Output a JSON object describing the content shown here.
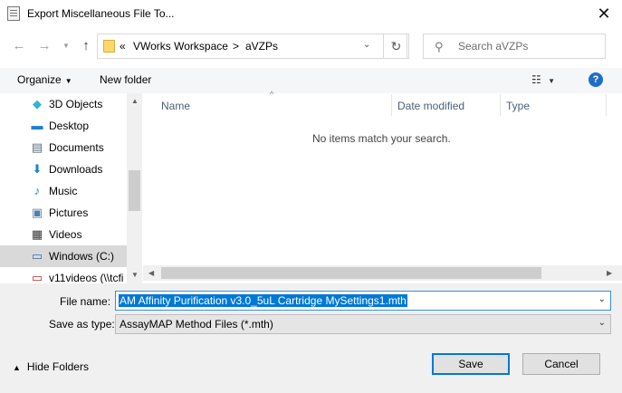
{
  "window": {
    "title": "Export Miscellaneous File To..."
  },
  "nav": {
    "back_icon": "arrow-left-icon",
    "forward_icon": "arrow-right-icon",
    "recent_icon": "chevron-down-icon",
    "up_icon": "arrow-up-icon"
  },
  "address": {
    "overflow": "«",
    "crumbs": [
      "VWorks Workspace",
      "aVZPs"
    ],
    "separator": ">"
  },
  "search": {
    "placeholder": "Search aVZPs"
  },
  "toolbar": {
    "organize": "Organize",
    "new_folder": "New folder",
    "help": "?"
  },
  "sidebar": {
    "items": [
      {
        "label": "3D Objects",
        "icon": "cube-icon"
      },
      {
        "label": "Desktop",
        "icon": "desktop-icon"
      },
      {
        "label": "Documents",
        "icon": "documents-icon"
      },
      {
        "label": "Downloads",
        "icon": "download-icon"
      },
      {
        "label": "Music",
        "icon": "music-icon"
      },
      {
        "label": "Pictures",
        "icon": "pictures-icon"
      },
      {
        "label": "Videos",
        "icon": "videos-icon"
      },
      {
        "label": "Windows (C:)",
        "icon": "drive-icon",
        "selected": true
      },
      {
        "label": "v11videos (\\\\tcfi",
        "icon": "network-drive-icon"
      }
    ]
  },
  "file_list": {
    "columns": [
      "Name",
      "Date modified",
      "Type"
    ],
    "empty_message": "No items match your search."
  },
  "form": {
    "file_name_label": "File name:",
    "file_name_value": "AM Affinity Purification v3.0_5uL Cartridge MySettings1.mth",
    "save_type_label": "Save as type:",
    "save_type_value": "AssayMAP Method Files (*.mth)"
  },
  "footer": {
    "hide_folders": "Hide Folders",
    "save": "Save",
    "cancel": "Cancel"
  },
  "colors": {
    "accent": "#0078d7",
    "selection": "#d9d9d9",
    "header_text": "#4c607a"
  }
}
